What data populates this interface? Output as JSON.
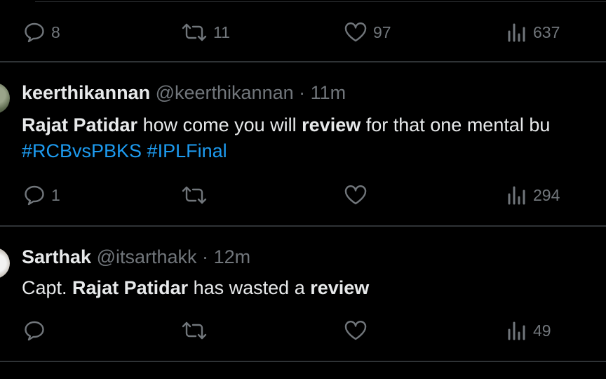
{
  "prev_tweet": {
    "actions": {
      "replies": "8",
      "reposts": "11",
      "likes": "97",
      "views": "637"
    }
  },
  "tweets": [
    {
      "name": "keerthikannan",
      "handle": "@keerthikannan",
      "separator": "·",
      "time": "11m",
      "text": {
        "bold1": "Rajat Patidar",
        "plain1": " how come you will ",
        "bold2": "review",
        "plain2": " for that one mental bu"
      },
      "hashtags": "#RCBvsPBKS #IPLFinal",
      "actions": {
        "replies": "1",
        "reposts": "",
        "likes": "",
        "views": "294"
      }
    },
    {
      "name": "Sarthak",
      "handle": "@itsarthakk",
      "separator": "·",
      "time": "12m",
      "text": {
        "plain0": "Capt. ",
        "bold1": "Rajat Patidar",
        "plain1": " has wasted a ",
        "bold2": "review"
      },
      "actions": {
        "replies": "",
        "reposts": "",
        "likes": "",
        "views": "49"
      }
    }
  ],
  "icons": {
    "reply": "reply-icon",
    "repost": "repost-icon",
    "like": "heart-icon",
    "views": "views-icon"
  },
  "colors": {
    "background": "#000000",
    "text": "#e7e9ea",
    "muted": "#71767b",
    "link": "#1d9bf0",
    "divider": "#2f3336"
  }
}
